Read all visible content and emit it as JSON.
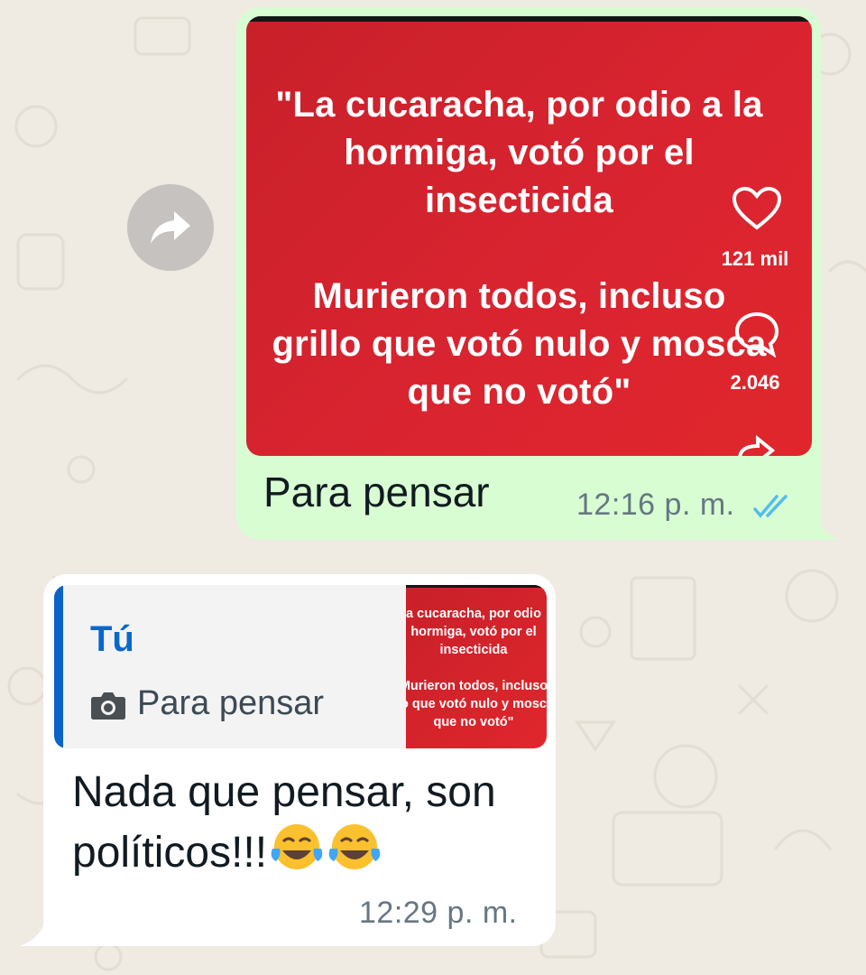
{
  "chat": {
    "forward_icon": "forward-arrow-icon",
    "outgoing": {
      "image": {
        "quote_text": "\"La cucaracha, por odio a la\nhormiga, votó por el\ninsecticida\n\nMurieron todos, incluso\ngrillo que votó nulo y mosca\nque no votó\"",
        "likes_count": "121 mil",
        "comments_count": "2.046"
      },
      "caption": "Para pensar",
      "time": "12:16 p. m.",
      "status": "read-double-check",
      "status_color": "#53bdeb"
    },
    "incoming": {
      "reply": {
        "author": "Tú",
        "text": "Para pensar",
        "icon": "camera-icon",
        "thumb_text": "a cucaracha, por odio\nhormiga, votó por el\ninsecticida\n\nMurieron todos, incluso\nllo que votó nulo y mosca\nque no votó\""
      },
      "text": "Nada que pensar, son políticos!!!",
      "emojis": [
        "face-with-tears-of-joy",
        "face-with-tears-of-joy"
      ],
      "time": "12:29 p. m."
    }
  },
  "colors": {
    "background": "#efeae2",
    "outgoing_bubble": "#d9fdd3",
    "incoming_bubble": "#ffffff",
    "image_red": "#d92430",
    "reply_accent": "#0a63c8"
  }
}
